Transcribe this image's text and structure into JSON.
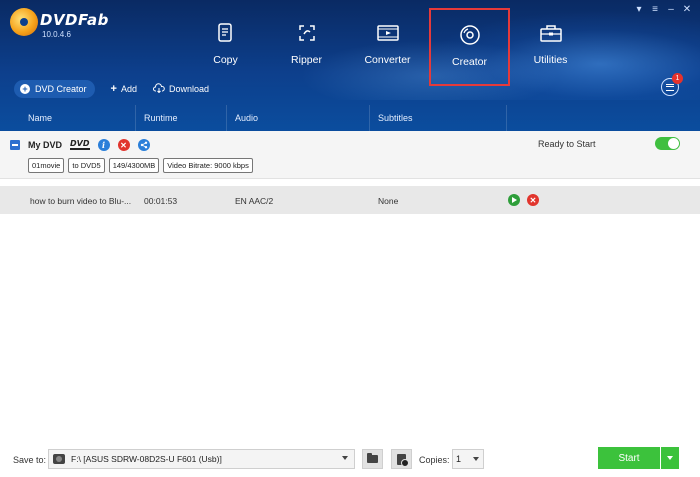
{
  "app": {
    "name": "DVDFab",
    "version": "10.0.4.6"
  },
  "window_controls": [
    "pin-icon",
    "menu-icon",
    "minimize-icon",
    "close-icon"
  ],
  "modules": [
    {
      "label": "Copy",
      "icon": "copy-icon",
      "selected": false
    },
    {
      "label": "Ripper",
      "icon": "ripper-icon",
      "selected": false
    },
    {
      "label": "Converter",
      "icon": "converter-icon",
      "selected": false
    },
    {
      "label": "Creator",
      "icon": "creator-disc-icon",
      "selected": true
    },
    {
      "label": "Utilities",
      "icon": "utilities-toolbox-icon",
      "selected": false
    }
  ],
  "toolbar": {
    "mode_label": "DVD Creator",
    "add_label": "Add",
    "download_label": "Download",
    "task_badge": "1"
  },
  "columns": {
    "name": "Name",
    "runtime": "Runtime",
    "audio": "Audio",
    "subtitles": "Subtitles"
  },
  "dvd": {
    "name": "My DVD",
    "logo_text": "DVD",
    "status": "Ready to Start",
    "toggle_on": true,
    "tags": [
      "01movie",
      "to DVD5",
      "149/4300MB",
      "Video Bitrate: 9000 kbps"
    ]
  },
  "titles": [
    {
      "name": "how to burn video to Blu-...",
      "runtime": "00:01:53",
      "audio": "EN  AAC/2",
      "subtitles": "None"
    }
  ],
  "bottom": {
    "save_to_label": "Save to:",
    "save_to_value": "F:\\ [ASUS SDRW-08D2S-U F601 (Usb)]",
    "copies_label": "Copies:",
    "copies_value": "1",
    "start_label": "Start"
  },
  "colors": {
    "header_blue": "#0d3f8c",
    "selected_outline": "#e53a3a",
    "start_green": "#3cc23c",
    "toggle_green": "#3fbf3f"
  }
}
